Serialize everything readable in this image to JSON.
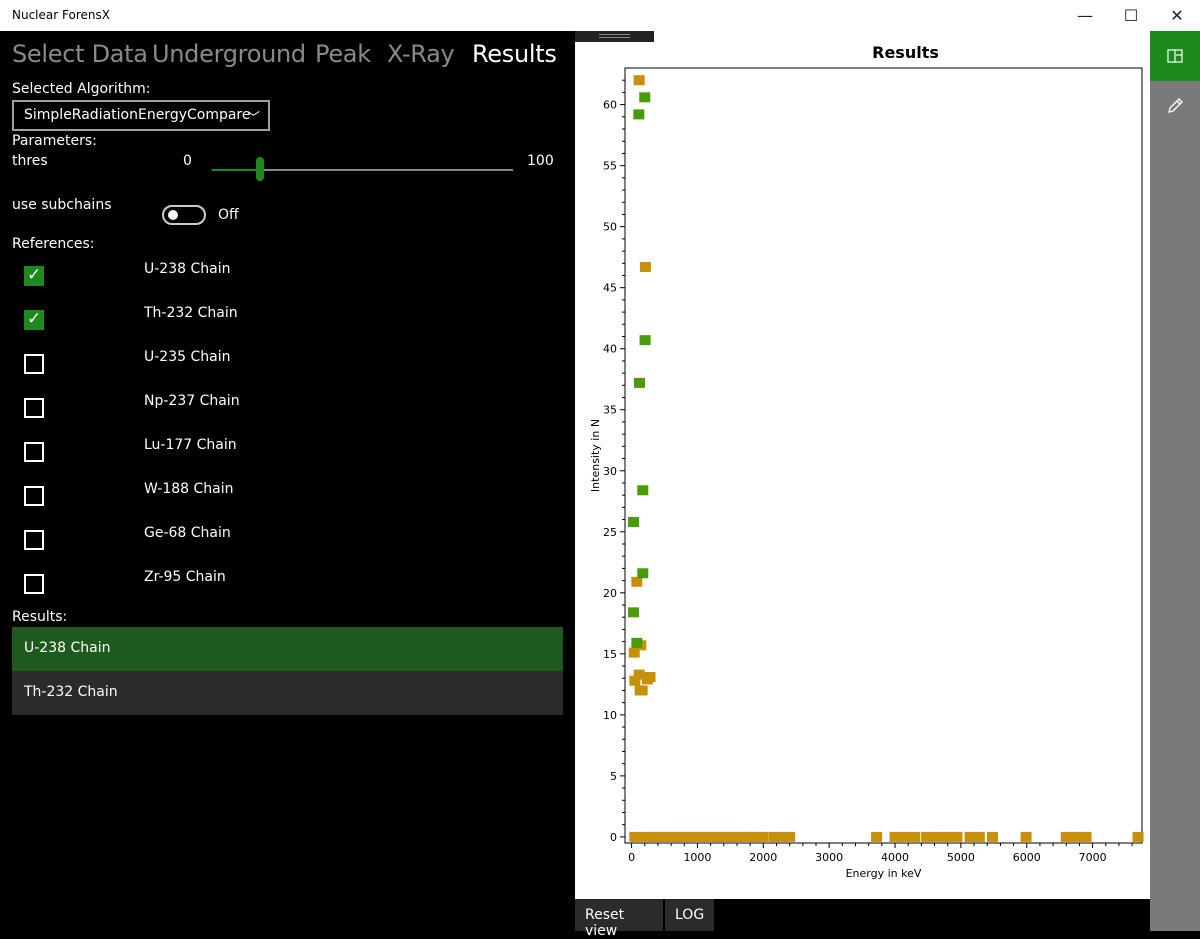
{
  "app": {
    "title": "Nuclear ForensX"
  },
  "window_controls": {
    "minimize": "—",
    "maximize": "☐",
    "close": "✕"
  },
  "tabs": [
    {
      "label": "Select Data",
      "active": false
    },
    {
      "label": "Underground",
      "active": false
    },
    {
      "label": "Peak",
      "active": false
    },
    {
      "label": "X-Ray",
      "active": false
    },
    {
      "label": "Results",
      "active": true
    }
  ],
  "algorithm": {
    "label": "Selected Algorithm:",
    "value": "SimpleRadiationEnergyCompare"
  },
  "parameters": {
    "label": "Parameters:",
    "thres": {
      "name": "thres",
      "min": "0",
      "max": "100",
      "value_fraction": 0.16
    },
    "subchains": {
      "name": "use subchains",
      "state": "Off"
    }
  },
  "references": {
    "label": "References:",
    "items": [
      {
        "label": "U-238 Chain",
        "checked": true
      },
      {
        "label": "Th-232 Chain",
        "checked": true
      },
      {
        "label": "U-235 Chain",
        "checked": false
      },
      {
        "label": "Np-237 Chain",
        "checked": false
      },
      {
        "label": "Lu-177 Chain",
        "checked": false
      },
      {
        "label": "W-188 Chain",
        "checked": false
      },
      {
        "label": "Ge-68 Chain",
        "checked": false
      },
      {
        "label": "Zr-95 Chain",
        "checked": false
      }
    ]
  },
  "results": {
    "label": "Results:",
    "items": [
      {
        "label": "U-238 Chain",
        "selected": true
      },
      {
        "label": "Th-232 Chain",
        "selected": false
      }
    ]
  },
  "bottom": {
    "reset_label": "Reset view",
    "log_label": "LOG"
  },
  "colors": {
    "accent": "#1e8a1e",
    "series_green": "#4a9a0a",
    "series_gold": "#c8900a"
  },
  "icons": {
    "sidebar_top": "panel-icon",
    "sidebar_edit": "pencil-icon"
  },
  "chart_data": {
    "type": "scatter",
    "title": "Results",
    "xlabel": "Energy in keV",
    "ylabel": "Intensity in N",
    "xlim": [
      -100,
      7750
    ],
    "ylim": [
      -0.5,
      63
    ],
    "x_ticks": [
      "0",
      "1000",
      "2000",
      "3000",
      "4000",
      "5000",
      "6000",
      "7000"
    ],
    "y_ticks": [
      "0",
      "5",
      "10",
      "15",
      "20",
      "25",
      "30",
      "35",
      "40",
      "45",
      "50",
      "55",
      "60"
    ],
    "grid": false,
    "series": [
      {
        "color": "#4a9a0a",
        "points": [
          [
            200,
            60.6
          ],
          [
            110,
            59.2
          ],
          [
            205,
            40.7
          ],
          [
            120,
            37.2
          ],
          [
            170,
            28.4
          ],
          [
            30,
            25.8
          ],
          [
            170,
            21.6
          ],
          [
            30,
            18.4
          ],
          [
            80,
            15.9
          ]
        ]
      },
      {
        "color": "#c8900a",
        "points": [
          [
            115,
            62.0
          ],
          [
            210,
            46.7
          ],
          [
            80,
            20.9
          ],
          [
            140,
            15.7
          ],
          [
            40,
            15.1
          ],
          [
            115,
            13.3
          ],
          [
            280,
            13.1
          ],
          [
            240,
            12.9
          ],
          [
            50,
            12.8
          ],
          [
            160,
            12.0
          ],
          [
            130,
            12.0
          ],
          [
            50,
            0
          ],
          [
            200,
            0
          ],
          [
            300,
            0
          ],
          [
            400,
            0
          ],
          [
            500,
            0
          ],
          [
            600,
            0
          ],
          [
            700,
            0
          ],
          [
            800,
            0
          ],
          [
            900,
            0
          ],
          [
            1000,
            0
          ],
          [
            1100,
            0
          ],
          [
            1200,
            0
          ],
          [
            1300,
            0
          ],
          [
            1400,
            0
          ],
          [
            1500,
            0
          ],
          [
            1600,
            0
          ],
          [
            1700,
            0
          ],
          [
            1800,
            0
          ],
          [
            1870,
            0
          ],
          [
            1990,
            0
          ],
          [
            2160,
            0
          ],
          [
            2280,
            0
          ],
          [
            2400,
            0
          ],
          [
            3720,
            0
          ],
          [
            4000,
            0
          ],
          [
            4150,
            0
          ],
          [
            4300,
            0
          ],
          [
            4480,
            0
          ],
          [
            4620,
            0
          ],
          [
            4780,
            0
          ],
          [
            4940,
            0
          ],
          [
            5140,
            0
          ],
          [
            5280,
            0
          ],
          [
            5480,
            0
          ],
          [
            5990,
            0
          ],
          [
            6600,
            0
          ],
          [
            6750,
            0
          ],
          [
            6900,
            0
          ],
          [
            7690,
            0
          ]
        ]
      }
    ]
  }
}
